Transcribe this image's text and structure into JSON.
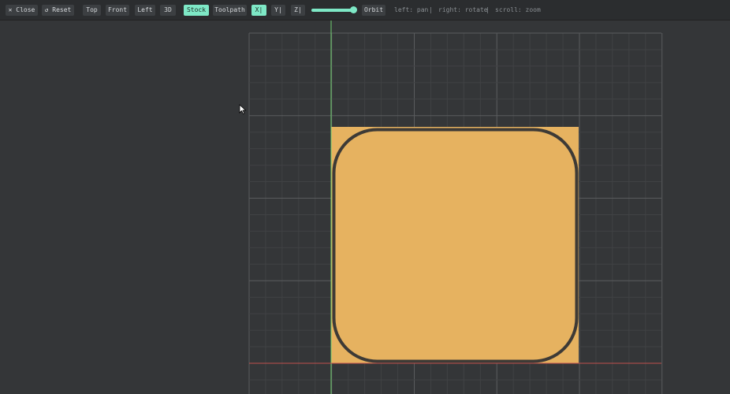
{
  "toolbar": {
    "close": "✕ Close",
    "reset": "↺ Reset",
    "views": [
      "Top",
      "Front",
      "Left",
      "3D"
    ],
    "stock": "Stock",
    "toolpath": "Toolpath",
    "axes": [
      "X|",
      "Y|",
      "Z|"
    ],
    "slider_value": 1.0,
    "orbit": "Orbit",
    "hints": [
      "left: pan",
      "|",
      "right: rotate",
      "|",
      "scroll: zoom"
    ]
  },
  "colors": {
    "accent": "#7ee8c6",
    "stock": "#e6b260",
    "outline": "#3d3a36",
    "x_axis": "#c0504d",
    "y_axis": "#6fd06f"
  }
}
